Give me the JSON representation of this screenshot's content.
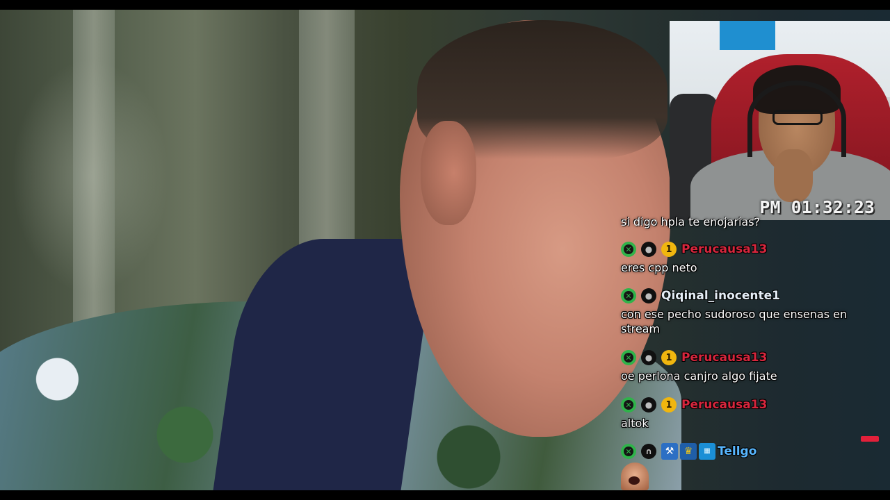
{
  "facecam": {
    "clock": "PM 01:32:23"
  },
  "chat": {
    "partial_message": "si digo hpla te enojarias?",
    "messages": [
      {
        "badges": [
          "x-badge",
          "user-badge",
          "tier-1-badge"
        ],
        "badge_tier": "1",
        "username": "Perucausa13",
        "username_color": "#d7263d",
        "text": "eres cpp neto"
      },
      {
        "badges": [
          "x-badge",
          "user-badge"
        ],
        "username": "Qiqinal_inocente1",
        "username_color": "#e4ecf5",
        "text": "con ese pecho sudoroso que ensenas en stream"
      },
      {
        "badges": [
          "x-badge",
          "user-badge",
          "tier-1-badge"
        ],
        "badge_tier": "1",
        "username": "Perucausa13",
        "username_color": "#d7263d",
        "text": "oe perlona canjro algo fijate"
      },
      {
        "badges": [
          "x-badge",
          "user-badge",
          "tier-1-badge"
        ],
        "badge_tier": "1",
        "username": "Perucausa13",
        "username_color": "#d7263d",
        "text": "altok"
      },
      {
        "badges": [
          "x-badge",
          "headset-badge",
          "wrench-badge",
          "crown-badge",
          "tg-badge"
        ],
        "username": "Tellgo",
        "username_color": "#58b7ff",
        "text": ""
      }
    ]
  },
  "colors": {
    "letterbox": "#000000",
    "x_badge": "#2fb34a",
    "tier_badge": "#f0b60f",
    "live_indicator": "#e3203a"
  }
}
